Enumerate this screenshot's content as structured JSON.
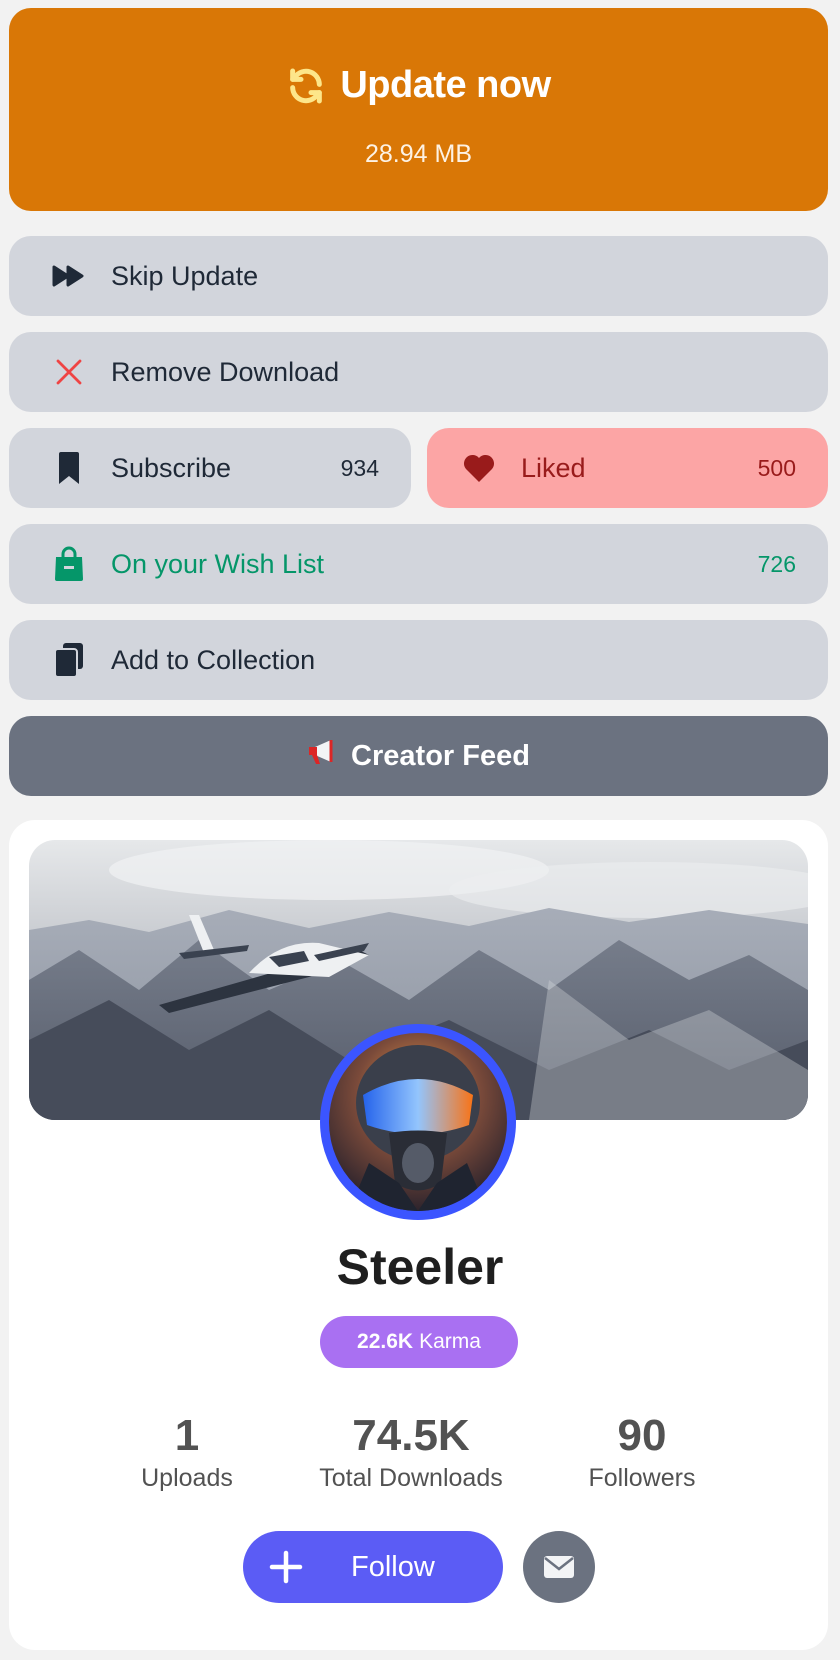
{
  "update": {
    "title": "Update now",
    "size": "28.94 MB",
    "icon": "refresh-icon",
    "color": "#d77605"
  },
  "actions": {
    "skip": {
      "label": "Skip Update",
      "icon": "fast-forward-icon"
    },
    "remove": {
      "label": "Remove Download",
      "icon": "close-icon"
    },
    "subscribe": {
      "label": "Subscribe",
      "count": "934",
      "icon": "bookmark-icon"
    },
    "liked": {
      "label": "Liked",
      "count": "500",
      "icon": "heart-icon",
      "color": "#fca5a5"
    },
    "wishlist": {
      "label": "On your Wish List",
      "count": "726",
      "icon": "shopping-bag-icon",
      "color": "#059669"
    },
    "collection": {
      "label": "Add to Collection",
      "icon": "clipboard-icon"
    },
    "feed": {
      "label": "Creator Feed",
      "icon": "megaphone-icon"
    }
  },
  "profile": {
    "name": "Steeler",
    "karma_value": "22.6K",
    "karma_label": "Karma",
    "stats": [
      {
        "value": "1",
        "label": "Uploads"
      },
      {
        "value": "74.5K",
        "label": "Total Downloads"
      },
      {
        "value": "90",
        "label": "Followers"
      }
    ],
    "follow_label": "Follow",
    "message_icon": "envelope-icon"
  }
}
